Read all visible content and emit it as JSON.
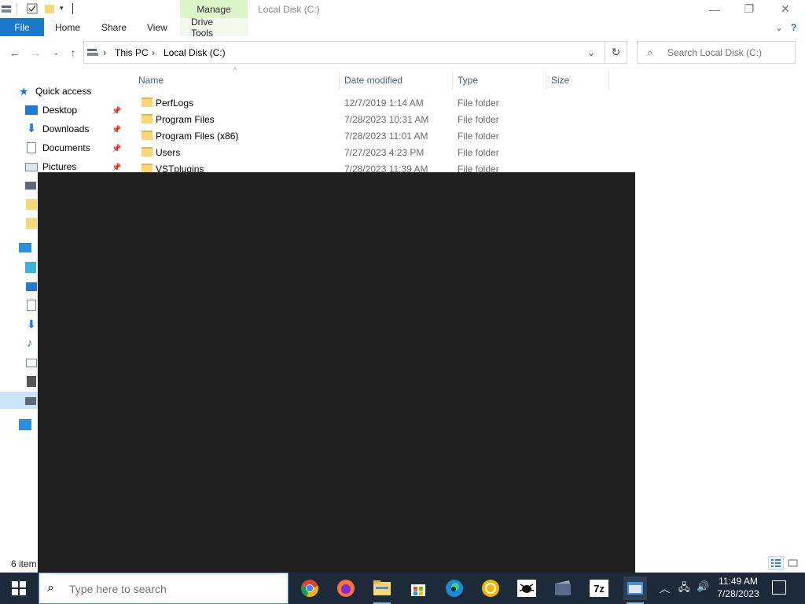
{
  "titlebar": {
    "manage_label": "Manage",
    "title": "Local Disk (C:)",
    "min_glyph": "—",
    "restore_glyph": "❐",
    "close_glyph": "✕"
  },
  "ribbon": {
    "file": "File",
    "home": "Home",
    "share": "Share",
    "view": "View",
    "drive_tools": "Drive Tools",
    "expand_glyph": "⌄",
    "help_glyph": "?"
  },
  "address": {
    "crumbs": [
      "This PC",
      "Local Disk (C:)"
    ],
    "separator": "›"
  },
  "search": {
    "placeholder": "Search Local Disk (C:)"
  },
  "navpane": {
    "quick_access": "Quick access",
    "items": [
      "Desktop",
      "Downloads",
      "Documents",
      "Pictures"
    ]
  },
  "columns": {
    "name": "Name",
    "date_modified": "Date modified",
    "type": "Type",
    "size": "Size"
  },
  "files": [
    {
      "name": "PerfLogs",
      "date": "12/7/2019 1:14 AM",
      "type": "File folder"
    },
    {
      "name": "Program Files",
      "date": "7/28/2023 10:31 AM",
      "type": "File folder"
    },
    {
      "name": "Program Files (x86)",
      "date": "7/28/2023 11:01 AM",
      "type": "File folder"
    },
    {
      "name": "Users",
      "date": "7/27/2023 4:23 PM",
      "type": "File folder"
    },
    {
      "name": "VSTplugins",
      "date": "7/28/2023 11:39 AM",
      "type": "File folder"
    }
  ],
  "status": {
    "count": "6 item"
  },
  "taskbar": {
    "search_placeholder": "Type here to search",
    "seven_zip_label": "7z",
    "time": "11:49 AM",
    "date": "7/28/2023"
  },
  "colors": {
    "file_tab": "#1979ca",
    "manage_tab": "#dcf5c8",
    "taskbar": "#1c2a3a",
    "folder": "#f8d775"
  }
}
